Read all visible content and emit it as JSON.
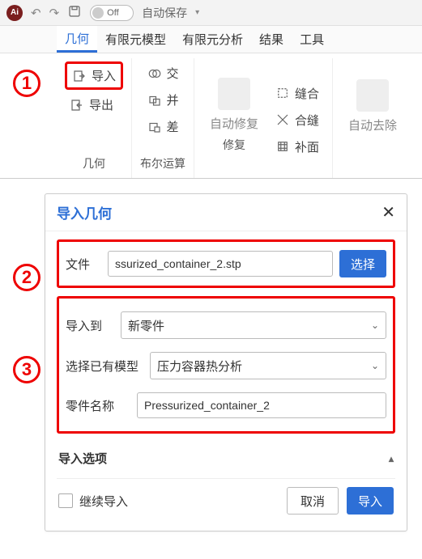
{
  "titlebar": {
    "toggle_label": "Off",
    "autosave_label": "自动保存"
  },
  "menu": {
    "items": [
      "几何",
      "有限元模型",
      "有限元分析",
      "结果",
      "工具"
    ],
    "active_index": 0
  },
  "ribbon": {
    "geometry": {
      "import": "导入",
      "export": "导出",
      "label": "几何"
    },
    "boolean": {
      "intersect": "交",
      "union": "并",
      "subtract": "差",
      "label": "布尔运算"
    },
    "repair": {
      "auto_repair": "自动修复",
      "sew": "缝合",
      "stitch": "合缝",
      "patch": "补面",
      "label": "修复"
    },
    "dedup": {
      "label": "自动去除"
    }
  },
  "callouts": {
    "n1": "1",
    "n2": "2",
    "n3": "3"
  },
  "dialog": {
    "title": "导入几何",
    "file_label": "文件",
    "file_value": "ssurized_container_2.stp",
    "choose_btn": "选择",
    "import_to_label": "导入到",
    "import_to_value": "新零件",
    "select_model_label": "选择已有模型",
    "select_model_value": "压力容器热分析",
    "part_name_label": "零件名称",
    "part_name_value": "Pressurized_container_2",
    "options_header": "导入选项",
    "continue_import": "继续导入",
    "cancel": "取消",
    "import": "导入"
  }
}
